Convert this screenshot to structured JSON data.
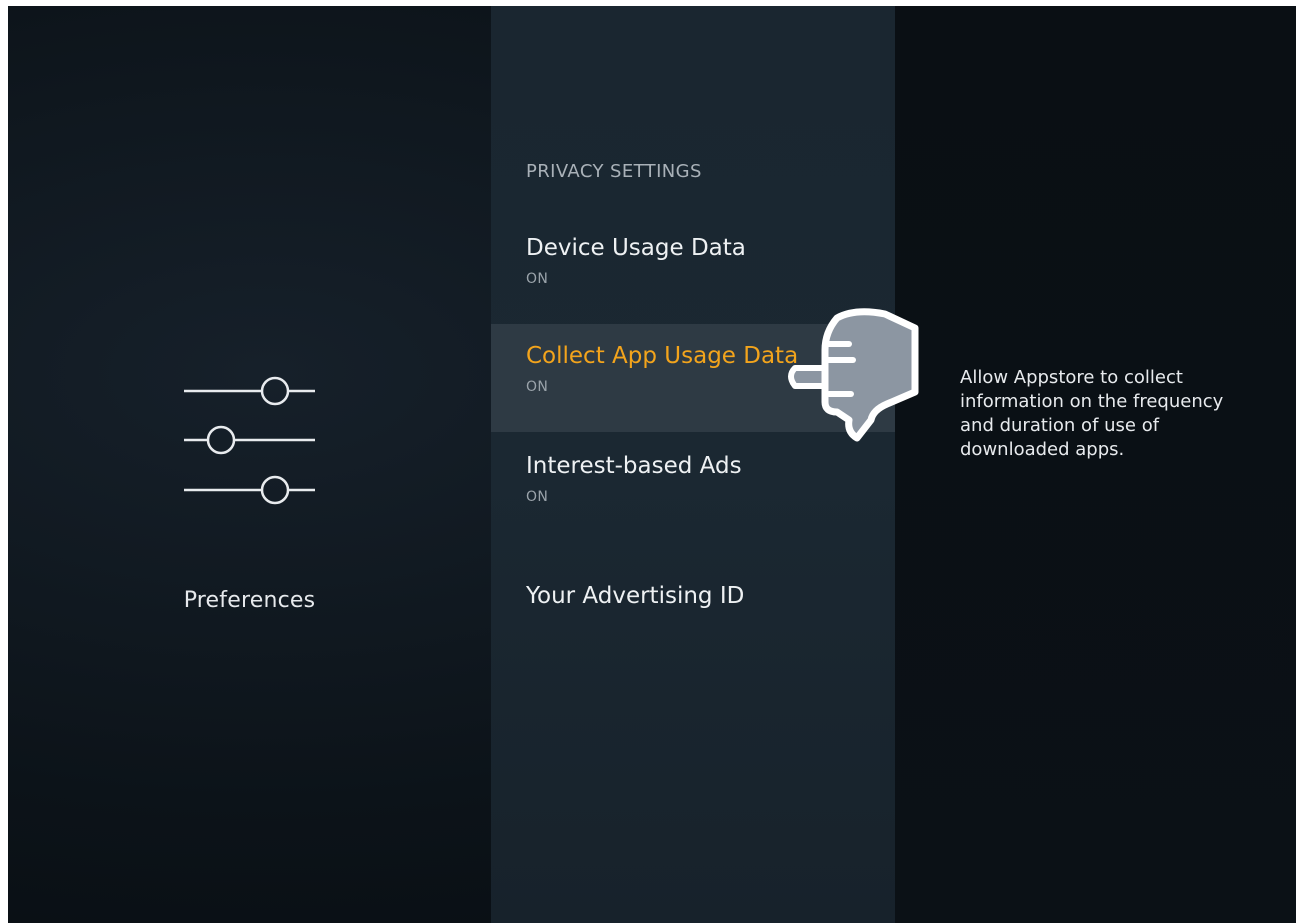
{
  "sidebar": {
    "category_label": "Preferences",
    "icon": "sliders-icon"
  },
  "settings": {
    "section_header": "PRIVACY SETTINGS",
    "items": [
      {
        "label": "Device Usage Data",
        "value": "ON"
      },
      {
        "label": "Collect App Usage Data",
        "value": "ON",
        "selected": true
      },
      {
        "label": "Interest-based Ads",
        "value": "ON"
      },
      {
        "label": "Your Advertising ID",
        "value": ""
      }
    ]
  },
  "detail": {
    "description": "Allow Appstore to collect information on the frequency and duration of use of downloaded apps."
  },
  "overlay": {
    "icon": "pointing-hand-icon"
  },
  "colors": {
    "accent": "#f3a41c",
    "selected_bg": "#2e3a44",
    "background": "#0c1319"
  }
}
